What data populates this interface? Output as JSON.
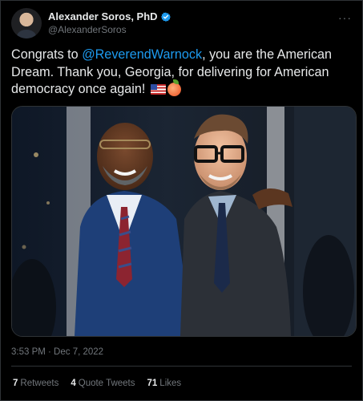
{
  "author": {
    "display_name": "Alexander Soros, PhD",
    "handle": "@AlexanderSoros"
  },
  "tweet": {
    "text_start": "Congrats to ",
    "mention": "@ReverendWarnock",
    "text_end": ", you are the American Dream. Thank you, Georgia, for delivering for American democracy once again!",
    "emojis": [
      "flag-us-icon",
      "peach-icon"
    ]
  },
  "more_label": "···",
  "timestamp": "3:53 PM · Dec 7, 2022",
  "stats": {
    "retweets_count": "7",
    "retweets_label": "Retweets",
    "quotes_count": "4",
    "quotes_label": "Quote Tweets",
    "likes_count": "71",
    "likes_label": "Likes"
  },
  "colors": {
    "background": "#000000",
    "text": "#e7e9ea",
    "secondary": "#71767b",
    "accent": "#1d9bf0",
    "border": "#2f3336"
  }
}
